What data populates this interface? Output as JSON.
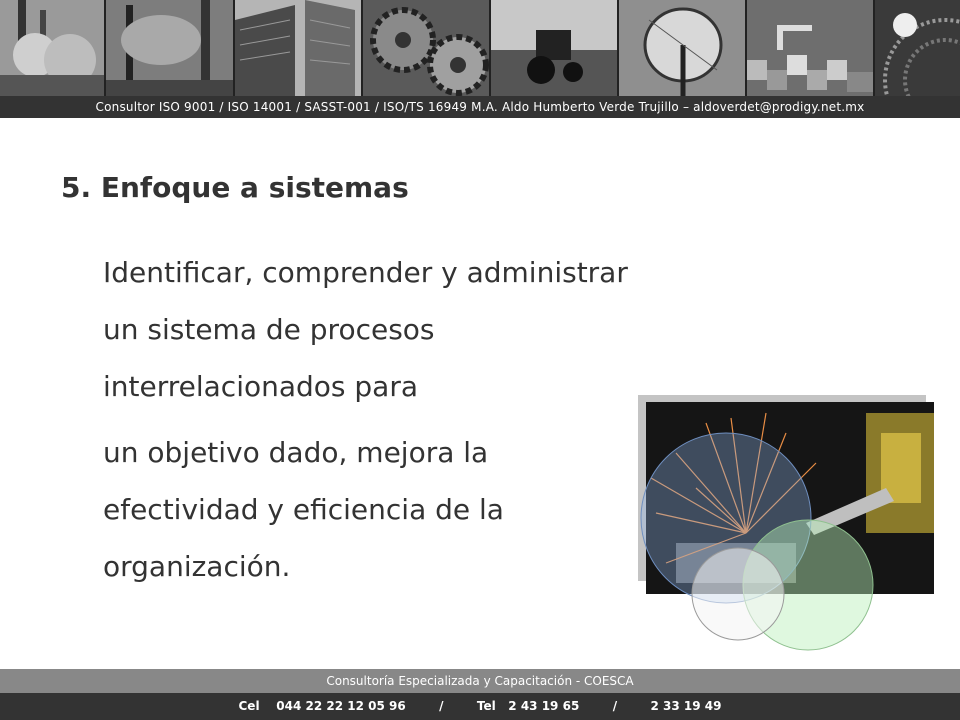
{
  "header": {
    "contact_line": "Consultor ISO 9001 / ISO 14001 / SASST-001 / ISO/TS 16949 M.A. Aldo Humberto Verde Trujillo  – aldoverdet@prodigy.net.mx"
  },
  "banner": {
    "images": [
      "smokestacks",
      "industrial-chimneys",
      "office-towers",
      "gears",
      "tractor-field",
      "satellite-dish",
      "machinery-pixels",
      "welder-turbine"
    ]
  },
  "slide": {
    "title": "5. Enfoque a sistemas",
    "paragraph_1": "Identificar, comprender y administrar un sistema de procesos interrelacionados para",
    "paragraph_2": "un objetivo dado, mejora la efectividad y eficiencia de la organización.",
    "illustration": "robotic-welding-sparks-with-circles"
  },
  "footer": {
    "company": "Consultoría Especializada y Capacitación  - COESCA",
    "phones": "Cel    044 22 22 12 05 96        /        Tel   2 43 19 65        /        2 33 19 49"
  },
  "colors": {
    "dark_strip": "#333333",
    "mid_strip": "#888888",
    "text": "#333333"
  }
}
